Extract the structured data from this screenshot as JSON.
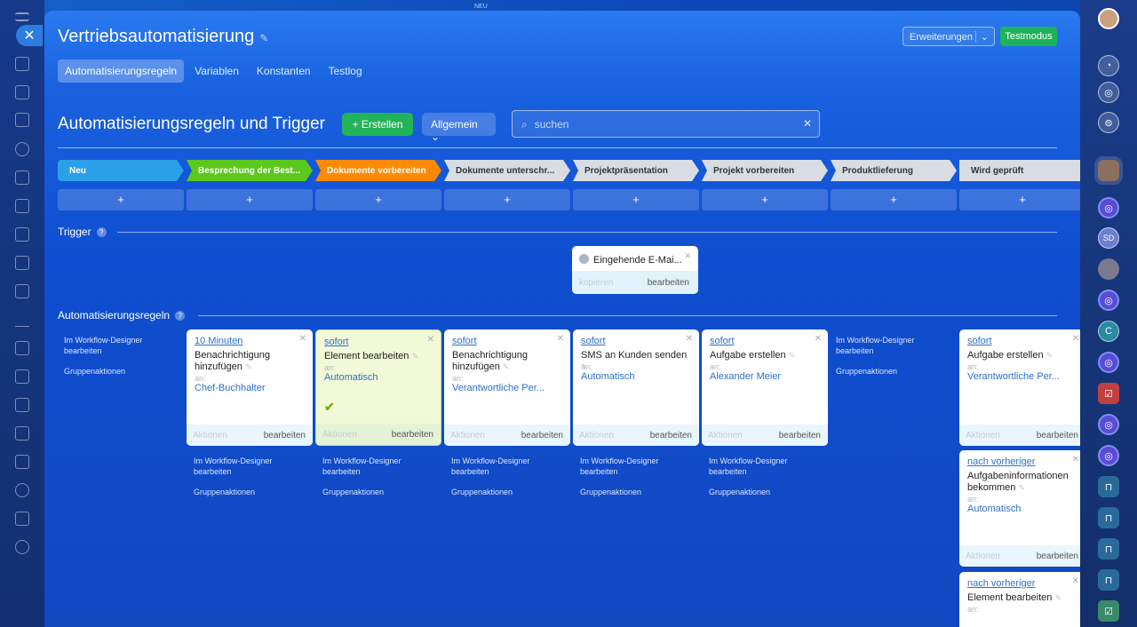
{
  "panel": {
    "title": "Vertriebsautomatisierung",
    "pin_icon": "pin-icon",
    "extensions_label": "Erweiterungen",
    "test_mode_label": "Testmodus",
    "tabs": [
      "Automatisierungsregeln",
      "Variablen",
      "Konstanten",
      "Testlog"
    ]
  },
  "toolbar": {
    "section_title": "Automatisierungsregeln und Trigger",
    "create_label": "+ Erstellen",
    "filter_label": "Allgemein",
    "search_placeholder": "suchen"
  },
  "stages": [
    {
      "label": "Neu",
      "color": "#2aa0e8",
      "text": "#ffffff"
    },
    {
      "label": "Besprechung der Best...",
      "color": "#5cc81c",
      "text": "#ffffff"
    },
    {
      "label": "Dokumente vorbereiten",
      "color": "#ff8a00",
      "text": "#ffffff"
    },
    {
      "label": "Dokumente unterschr...",
      "color": "#d8dde4",
      "text": "#333333"
    },
    {
      "label": "Projektpräsentation",
      "color": "#d8dde4",
      "text": "#333333"
    },
    {
      "label": "Projekt vorbereiten",
      "color": "#d8dde4",
      "text": "#333333"
    },
    {
      "label": "Produktlieferung",
      "color": "#d8dde4",
      "text": "#333333"
    },
    {
      "label": "Wird geprüft",
      "color": "#d8dde4",
      "text": "#333333"
    }
  ],
  "plus_label": "+",
  "trigger_section": {
    "label": "Trigger",
    "card": {
      "title": "Eingehende E-Mai...",
      "copy": "kopieren",
      "edit": "bearbeiten"
    }
  },
  "rules_section": {
    "label": "Automatisierungsregeln",
    "designer_line1": "Im Workflow-Designer",
    "designer_line2": "bearbeiten",
    "group_actions": "Gruppenaktionen",
    "an_label": "an:",
    "actions_label": "Aktionen",
    "edit_label": "bearbeiten",
    "cards": [
      {
        "when": "10 Minuten",
        "action": "Benachrichtigung hinzufügen",
        "who": "Chef-Buchhalter"
      },
      {
        "when": "sofort",
        "action": "Element bearbeiten",
        "who": "Automatisch"
      },
      {
        "when": "sofort",
        "action": "Benachrichtigung hinzufügen",
        "who": "Verantwortliche Per..."
      },
      {
        "when": "sofort",
        "action": "SMS an Kunden senden",
        "who": "Automatisch"
      },
      {
        "when": "sofort",
        "action": "Aufgabe erstellen",
        "who": "Alexander Meier"
      },
      {
        "when": "sofort",
        "action": "Aufgabe erstellen",
        "who": "Verantwortliche Per..."
      },
      {
        "when": "nach vorheriger",
        "action": "Aufgabeninformationen bekommen",
        "who": "Automatisch"
      },
      {
        "when": "nach vorheriger",
        "action": "Element bearbeiten",
        "who": ""
      }
    ]
  },
  "top_small_label": "NEU",
  "right_sidebar": {
    "c_label": "C",
    "sd_label": "SD"
  }
}
